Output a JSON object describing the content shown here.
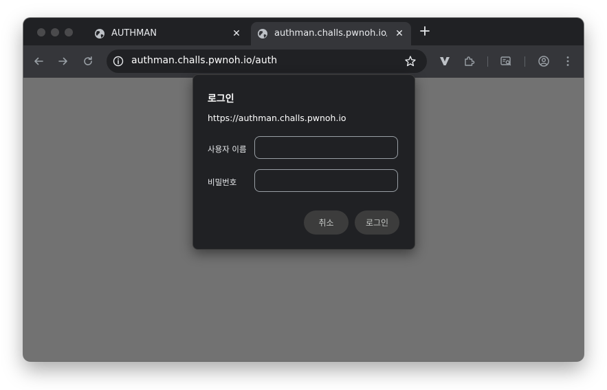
{
  "browser": {
    "tabs": [
      {
        "title": "AUTHMAN",
        "active": false
      },
      {
        "title": "authman.challs.pwnoh.io/auth",
        "active": true
      }
    ],
    "address_bar": {
      "url": "authman.challs.pwnoh.io/auth"
    }
  },
  "dialog": {
    "title": "로그인",
    "origin": "https://authman.challs.pwnoh.io",
    "username_label": "사용자 이름",
    "username_value": "",
    "password_label": "비밀번호",
    "password_value": "",
    "cancel_label": "취소",
    "login_label": "로그인"
  },
  "icons": {
    "tab_favicon": "globe-icon",
    "tab_close": "close-icon",
    "new_tab": "plus-icon",
    "back": "arrow-left-icon",
    "forward": "arrow-right-icon",
    "reload": "reload-icon",
    "site_info": "info-icon",
    "bookmark": "star-icon",
    "extension_v": "vivaldi-v-icon",
    "extensions": "puzzle-icon",
    "reading_mode": "reading-mode-icon",
    "profile": "profile-icon",
    "menu": "kebab-menu-icon"
  },
  "colors": {
    "titlebar": "#202124",
    "toolbar": "#35363a",
    "content": "#727272",
    "dialog": "#202124"
  }
}
